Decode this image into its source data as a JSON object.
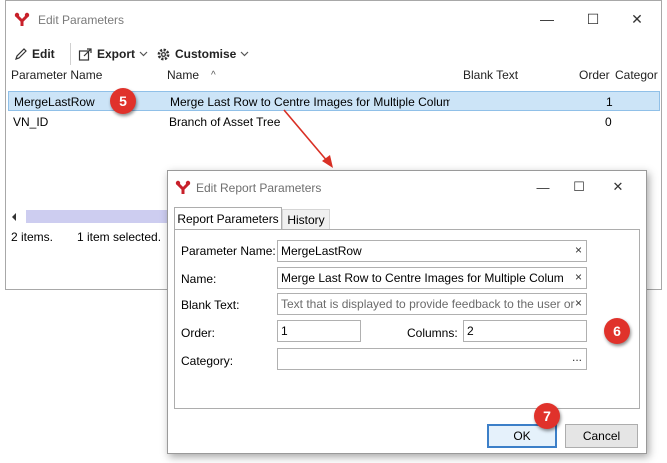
{
  "main_window": {
    "title": "Edit Parameters",
    "controls": {
      "minimize": "—",
      "maximize": "☐",
      "close": "✕"
    },
    "toolbar": {
      "edit_label": "Edit",
      "export_label": "Export",
      "customise_label": "Customise"
    },
    "columns": [
      "Parameter Name",
      "Name",
      "Blank Text",
      "Order",
      "Categor"
    ],
    "sort_glyph": "^",
    "rows": [
      {
        "param": "MergeLastRow",
        "name": "Merge Last Row to Centre Images for Multiple Colum",
        "blank": "",
        "order": "1"
      },
      {
        "param": "VN_ID",
        "name": "Branch of Asset Tree",
        "blank": "",
        "order": "0"
      }
    ],
    "status": {
      "items": "2 items.",
      "selected": "1 item selected."
    }
  },
  "dialog": {
    "title": "Edit Report Parameters",
    "controls": {
      "minimize": "—",
      "maximize": "☐",
      "close": "✕"
    },
    "tabs": [
      "Report Parameters",
      "History"
    ],
    "fields": {
      "parameter_name": {
        "label": "Parameter Name:",
        "value": "MergeLastRow"
      },
      "name": {
        "label": "Name:",
        "value": "Merge Last Row to Centre Images for Multiple Colum"
      },
      "blank_text": {
        "label": "Blank Text:",
        "placeholder": "Text that is displayed to provide feedback to the user or"
      },
      "order": {
        "label": "Order:",
        "value": "1"
      },
      "columns": {
        "label": "Columns:",
        "value": "2"
      },
      "category": {
        "label": "Category:",
        "value": "",
        "ellipsis": "..."
      }
    },
    "clear_glyph": "×",
    "ok_label": "OK",
    "cancel_label": "Cancel"
  },
  "badges": {
    "b5": "5",
    "b6": "6",
    "b7": "7"
  },
  "colors": {
    "badge": "#e0322b",
    "selection": "#cce4f7",
    "accent": "#3c7fc8",
    "arrow": "#d93025",
    "logo": "#c8202a"
  }
}
